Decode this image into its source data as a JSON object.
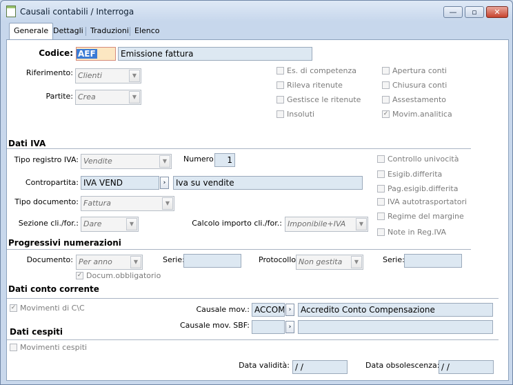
{
  "window": {
    "title": "Causali contabili / Interroga",
    "minimize": "—",
    "restore": "▫",
    "close": "✕"
  },
  "tabs": [
    "Generale",
    "Dettagli",
    "Traduzioni",
    "Elenco"
  ],
  "form": {
    "codice_label": "Codice:",
    "codice_value": "AEF",
    "descrizione_value": "Emissione fattura",
    "riferimento_label": "Riferimento:",
    "riferimento_value": "Clienti",
    "partite_label": "Partite:",
    "partite_value": "Crea",
    "checkbox_col1": [
      {
        "label": "Es. di competenza",
        "checked": false
      },
      {
        "label": "Rileva ritenute",
        "checked": false
      },
      {
        "label": "Gestisce le ritenute",
        "checked": false
      },
      {
        "label": "Insoluti",
        "checked": false
      }
    ],
    "checkbox_col2": [
      {
        "label": "Apertura conti",
        "checked": false
      },
      {
        "label": "Chiusura conti",
        "checked": false
      },
      {
        "label": "Assestamento",
        "checked": false
      },
      {
        "label": "Movim.analitica",
        "checked": true
      }
    ]
  },
  "iva": {
    "section_title": "Dati IVA",
    "tipo_registro_label": "Tipo registro IVA:",
    "tipo_registro_value": "Vendite",
    "numero_label": "Numero:",
    "numero_value": "1",
    "contropartita_label": "Contropartita:",
    "contropartita_code": "IVA VEND",
    "contropartita_desc": "Iva su vendite",
    "tipo_documento_label": "Tipo documento:",
    "tipo_documento_value": "Fattura",
    "sezione_label": "Sezione cli./for.:",
    "sezione_value": "Dare",
    "calcolo_label": "Calcolo importo cli./for.:",
    "calcolo_value": "Imponibile+IVA",
    "checkboxes": [
      {
        "label": "Controllo univocità",
        "checked": false
      },
      {
        "label": "Esigib.differita",
        "checked": false
      },
      {
        "label": "Pag.esigib.differita",
        "checked": false
      },
      {
        "label": "IVA autotrasportatori",
        "checked": false
      },
      {
        "label": "Regime del margine",
        "checked": false
      },
      {
        "label": "Note in Reg.IVA",
        "checked": false
      }
    ]
  },
  "progressivi": {
    "section_title": "Progressivi numerazioni",
    "documento_label": "Documento:",
    "documento_value": "Per anno",
    "serie_label": "Serie:",
    "serie_value": "",
    "protocollo_label": "Protocollo:",
    "protocollo_value": "Non gestita",
    "serie2_label": "Serie:",
    "serie2_value": "",
    "docum_obbl_label": "Docum.obbligatorio",
    "docum_obbl_checked": true
  },
  "conto_corrente": {
    "section_title": "Dati conto corrente",
    "movimenti_label": "Movimenti di C\\C",
    "movimenti_checked": true,
    "causale_mov_label": "Causale mov.:",
    "causale_mov_code": "ACCOM",
    "causale_mov_desc": "Accredito Conto Compensazione",
    "causale_sbf_label": "Causale mov. SBF:",
    "causale_sbf_code": "",
    "causale_sbf_desc": ""
  },
  "cespiti": {
    "section_title": "Dati cespiti",
    "movimenti_label": "Movimenti cespiti",
    "movimenti_checked": false
  },
  "date": {
    "validita_label": "Data validità:",
    "validita_value": " /  /",
    "obsolescenza_label": "Data obsolescenza:",
    "obsolescenza_value": " /  /"
  },
  "colors": {
    "field_bg": "#dde8f2",
    "codice_highlight": "#3a7bd5",
    "codice_field": "#fce7c2"
  }
}
